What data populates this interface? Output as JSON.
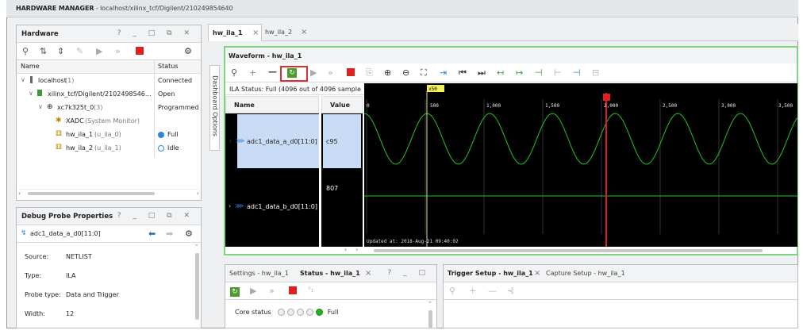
{
  "title_main": "HARDWARE MANAGER",
  "title_path": " - localhost/xilinx_tcf/Digilent/210249854640",
  "hardware": {
    "title": "Hardware",
    "controls": "? _ □ ⧉ ✕",
    "col_name": "Name",
    "col_status": "Status",
    "rows": [
      {
        "name": "localhost",
        "extra": "(1)",
        "status": "Connected"
      },
      {
        "name": "xilinx_tcf/Digilent/2102498546...",
        "extra": "",
        "status": "Open"
      },
      {
        "name": "xc7k325t_0",
        "extra": "(3)",
        "status": "Programmed"
      },
      {
        "name": "XADC",
        "extra": "(System Monitor)",
        "status": ""
      },
      {
        "name": "hw_ila_1",
        "extra": "(u_ila_0)",
        "status": "Full"
      },
      {
        "name": "hw_ila_2",
        "extra": "(u_ila_1)",
        "status": "Idle"
      }
    ]
  },
  "debug_probe": {
    "title": "Debug Probe Properties",
    "controls": "? _ □ ⧉ ✕",
    "probe": "adc1_data_a_d0[11:0]",
    "props": [
      {
        "label": "Source:",
        "value": "NETLIST"
      },
      {
        "label": "Type:",
        "value": "ILA"
      },
      {
        "label": "Probe type:",
        "value": "Data and Trigger"
      },
      {
        "label": "Width:",
        "value": "12"
      }
    ]
  },
  "tabs": {
    "tab1": "hw_ila_1",
    "tab2": "hw_ila_2",
    "close": "×",
    "side_label": "Dashboard Options"
  },
  "waveform": {
    "title": "Waveform - hw_ila_1",
    "status": "ILA Status:  Full (4096 out of 4096 sample",
    "col_name": "Name",
    "col_value": "Value",
    "signals": [
      {
        "name": "adc1_data_a_d0[11:0]",
        "value": "c95"
      },
      {
        "name": "adc1_data_b_d0[11:0]",
        "value": "807"
      }
    ],
    "cursor_label": "x50",
    "ticks": [
      "0",
      "500",
      "1,000",
      "1,500",
      "2,000",
      "2,500",
      "3,000",
      "3,500"
    ],
    "updated": "Updated at: 2018-Aug-21 09:40:02",
    "wave_color": "#22c322",
    "marker_color": "#e02020"
  },
  "settings_panel": {
    "tab1": "Settings - hw_ila_1",
    "tab2": "Status - hw_ila_1",
    "close": "×",
    "controls": "? _ □",
    "core_status_label": "Core status",
    "core_status_value": "Full"
  },
  "trigger_panel": {
    "tab1": "Trigger Setup - hw_ila_1",
    "tab2": "Capture Setup - hw_ila_1",
    "close": "×"
  }
}
